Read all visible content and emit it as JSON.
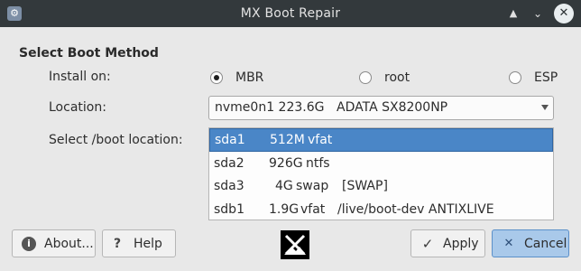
{
  "window": {
    "title": "MX Boot Repair",
    "controls": {
      "minimize": "▲",
      "maximize": "⌄",
      "close": "✕"
    }
  },
  "section": {
    "title": "Select Boot Method"
  },
  "install_on": {
    "label": "Install on:",
    "options": [
      {
        "label": "MBR",
        "selected": true
      },
      {
        "label": "root",
        "selected": false
      },
      {
        "label": "ESP",
        "selected": false
      }
    ]
  },
  "location": {
    "label": "Location:",
    "device": "nvme0n1 223.6G",
    "model": "ADATA SX8200NP"
  },
  "boot_location": {
    "label": "Select /boot location:",
    "items": [
      {
        "name": "sda1",
        "size": "512M",
        "fs": "vfat",
        "extra": "",
        "selected": true
      },
      {
        "name": "sda2",
        "size": "926G",
        "fs": "ntfs",
        "extra": "",
        "selected": false
      },
      {
        "name": "sda3",
        "size": "4G",
        "fs": "swap",
        "extra": "[SWAP]",
        "selected": false
      },
      {
        "name": "sdb1",
        "size": "1.9G",
        "fs": "vfat",
        "extra": "/live/boot-dev ANTIXLIVE",
        "selected": false
      }
    ]
  },
  "buttons": {
    "about": "About...",
    "help": "Help",
    "apply": "Apply",
    "cancel": "Cancel"
  },
  "colors": {
    "titlebar": "#33393c",
    "selection": "#4a86c7",
    "cancel_bg": "#a9c9ea"
  }
}
